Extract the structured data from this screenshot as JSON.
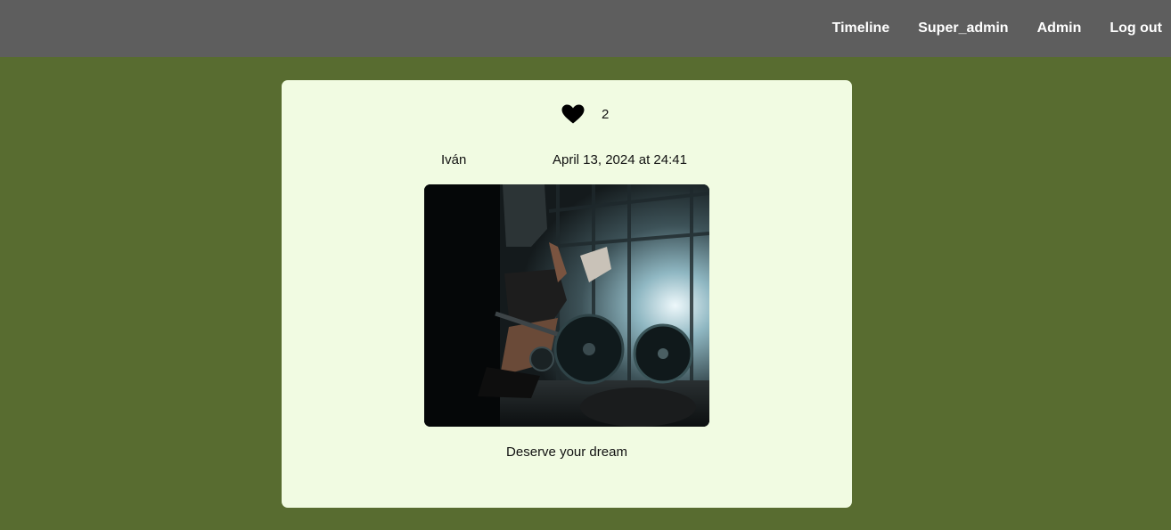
{
  "nav": {
    "items": [
      {
        "label": "Timeline"
      },
      {
        "label": "Super_admin"
      },
      {
        "label": "Admin"
      },
      {
        "label": "Log out"
      }
    ]
  },
  "post": {
    "like_icon": "heart-icon",
    "like_count": "2",
    "author": "Iván",
    "date": "April 13, 2024 at 24:41",
    "caption": "Deserve your dream"
  },
  "colors": {
    "topbar": "#5e5e5e",
    "background": "#586c30",
    "card": "#f1fbe2",
    "heart": "#000000"
  }
}
